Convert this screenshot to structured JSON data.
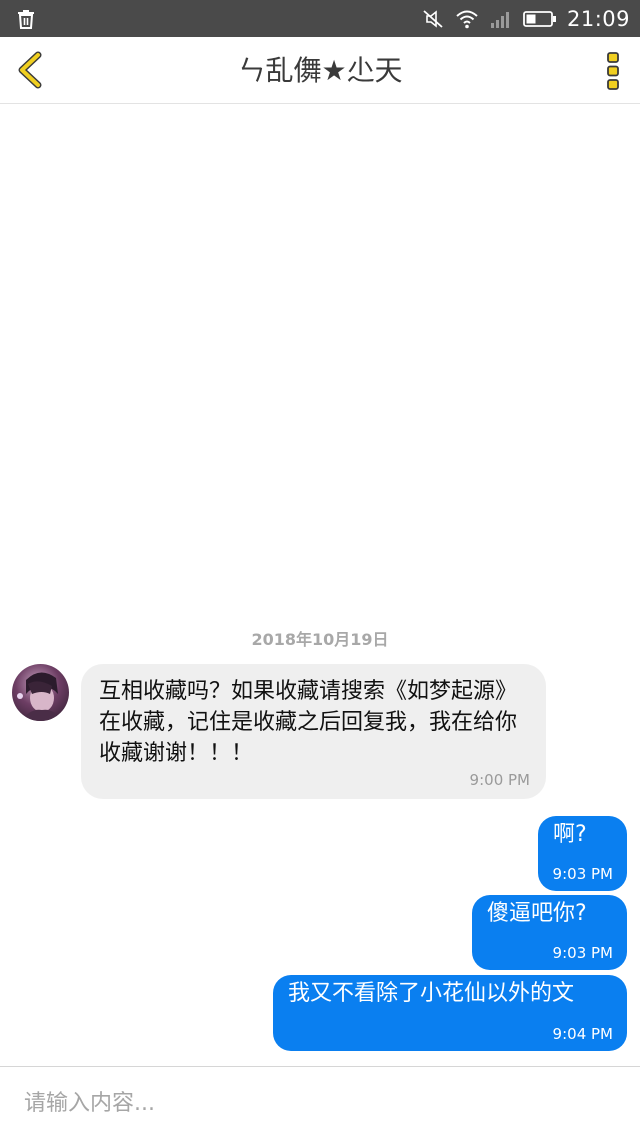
{
  "status_bar": {
    "time": "21:09",
    "icons": [
      "trash-icon",
      "mute-icon",
      "wifi-icon",
      "signal-icon",
      "battery-icon"
    ]
  },
  "nav": {
    "title": "ㄣ乱儛★尐天",
    "back_icon": "chevron-left-icon",
    "more_icon": "more-vertical-icon",
    "accent_color": "#e6c300"
  },
  "chat": {
    "date": "2018年10月19日",
    "messages": [
      {
        "direction": "incoming",
        "text": "互相收藏吗？如果收藏请搜索《如梦起源》在收藏，记住是收藏之后回复我，我在给你收藏谢谢！！！",
        "time": "9:00 PM"
      },
      {
        "direction": "outgoing",
        "text": "啊?",
        "time": "9:03 PM"
      },
      {
        "direction": "outgoing",
        "text": "傻逼吧你?",
        "time": "9:03 PM"
      },
      {
        "direction": "outgoing",
        "text": "我又不看除了小花仙以外的文",
        "time": "9:04 PM"
      }
    ],
    "incoming_bubble_color": "#efefef",
    "outgoing_bubble_color": "#0a7ff0"
  },
  "input": {
    "placeholder": "请输入内容..."
  }
}
